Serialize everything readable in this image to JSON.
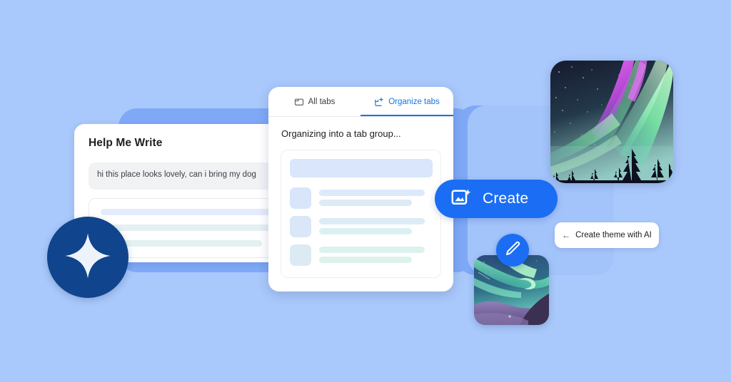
{
  "background": {
    "color": "#a9c8fb",
    "panel_left_color": "#7fa9f7",
    "panel_right_back_color": "#7fa9f7",
    "panel_right_front_color": "#a3c4fb"
  },
  "help_me_write": {
    "title": "Help Me Write",
    "prompt_value": "hi this place looks lovely, can i bring my dog",
    "placeholder_lines": 3
  },
  "organize_tabs": {
    "tabs": [
      {
        "label": "All tabs",
        "icon": "browser-tab-icon",
        "active": false
      },
      {
        "label": "Organize tabs",
        "icon": "organize-tabs-icon",
        "active": true
      }
    ],
    "status_text": "Organizing into a tab group...",
    "accent_color": "#1a73e8",
    "rows": 3
  },
  "create_button": {
    "label": "Create",
    "icon": "image-sparkle-icon",
    "color": "#1b6ef3"
  },
  "theme_chip": {
    "arrow": "←",
    "label": "Create theme with AI"
  },
  "gemini_badge": {
    "icon": "sparkle-icon",
    "color": "#10448c"
  },
  "edit_badge": {
    "icon": "pencil-icon",
    "color": "#1b6ef3"
  },
  "aurora_images": [
    {
      "name": "aurora-large",
      "description": "Starry night sky with magenta and green aurora over pine trees"
    },
    {
      "name": "aurora-small",
      "description": "Teal green aurora over purple mountain ridge"
    }
  ]
}
